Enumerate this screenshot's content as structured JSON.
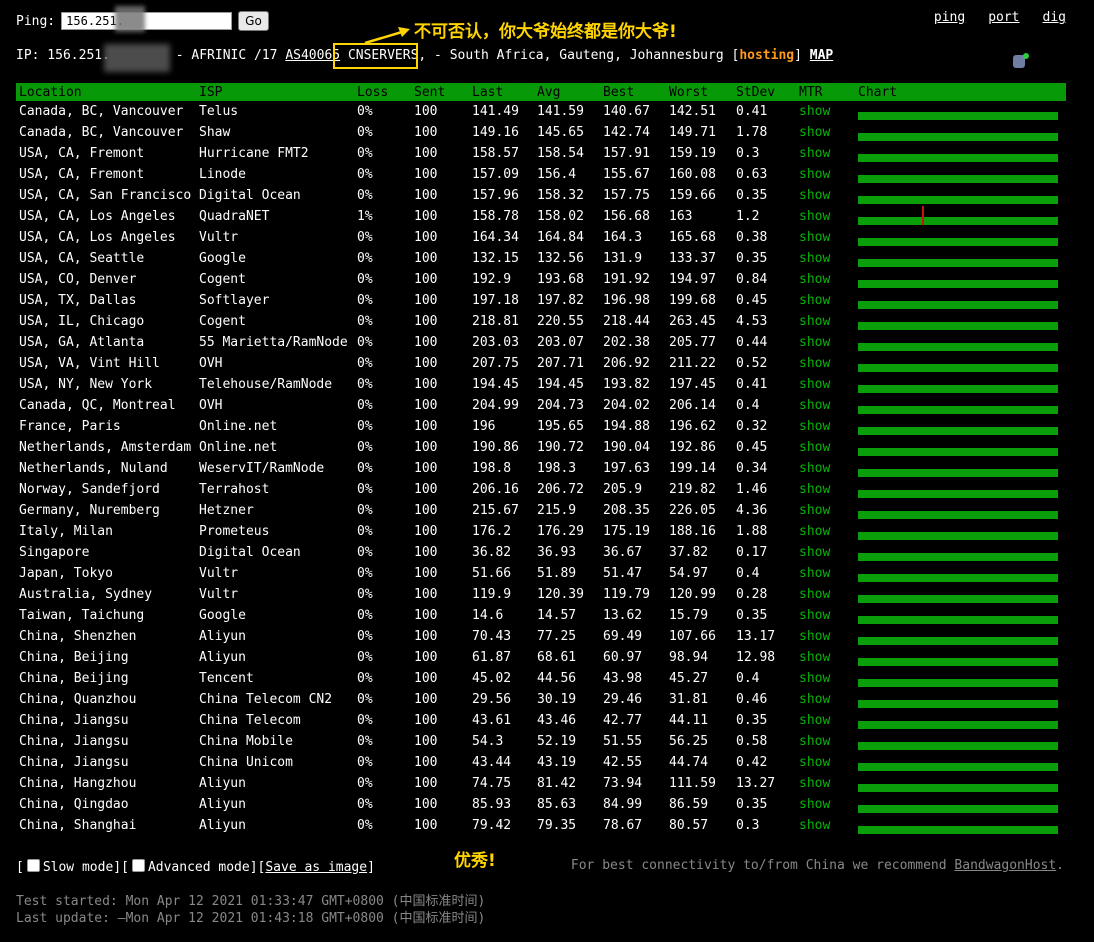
{
  "toolbar": {
    "ping_label": "Ping:",
    "ip_value": "156.251.",
    "go_label": "Go",
    "links": [
      "ping",
      "port",
      "dig"
    ]
  },
  "ip_info": {
    "prefix": "IP: 156.251.",
    "mid": " - AFRINIC /17 ",
    "asn": "AS40065",
    "org": "CNSERVERS,",
    "location": " - South Africa, Gauteng, Johannesburg [",
    "hosting": "hosting",
    "close": "] ",
    "map": "MAP"
  },
  "annotations": {
    "top": "不可否认，你大爷始终都是你大爷!",
    "bottom": "优秀!"
  },
  "table": {
    "headers": [
      "Location",
      "ISP",
      "Loss",
      "Sent",
      "Last",
      "Avg",
      "Best",
      "Worst",
      "StDev",
      "MTR",
      "Chart"
    ],
    "rows": [
      {
        "location": "Canada, BC, Vancouver",
        "isp": "Telus",
        "loss": "0%",
        "sent": "100",
        "last": "141.49",
        "avg": "141.59",
        "best": "140.67",
        "worst": "142.51",
        "stdev": "0.41",
        "mtr": "show"
      },
      {
        "location": "Canada, BC, Vancouver",
        "isp": "Shaw",
        "loss": "0%",
        "sent": "100",
        "last": "149.16",
        "avg": "145.65",
        "best": "142.74",
        "worst": "149.71",
        "stdev": "1.78",
        "mtr": "show"
      },
      {
        "location": "USA, CA, Fremont",
        "isp": "Hurricane FMT2",
        "loss": "0%",
        "sent": "100",
        "last": "158.57",
        "avg": "158.54",
        "best": "157.91",
        "worst": "159.19",
        "stdev": "0.3",
        "mtr": "show"
      },
      {
        "location": "USA, CA, Fremont",
        "isp": "Linode",
        "loss": "0%",
        "sent": "100",
        "last": "157.09",
        "avg": "156.4",
        "best": "155.67",
        "worst": "160.08",
        "stdev": "0.63",
        "mtr": "show"
      },
      {
        "location": "USA, CA, San Francisco",
        "isp": "Digital Ocean",
        "loss": "0%",
        "sent": "100",
        "last": "157.96",
        "avg": "158.32",
        "best": "157.75",
        "worst": "159.66",
        "stdev": "0.35",
        "mtr": "show"
      },
      {
        "location": "USA, CA, Los Angeles",
        "isp": "QuadraNET",
        "loss": "1%",
        "sent": "100",
        "last": "158.78",
        "avg": "158.02",
        "best": "156.68",
        "worst": "163",
        "stdev": "1.2",
        "mtr": "show",
        "spike": true
      },
      {
        "location": "USA, CA, Los Angeles",
        "isp": "Vultr",
        "loss": "0%",
        "sent": "100",
        "last": "164.34",
        "avg": "164.84",
        "best": "164.3",
        "worst": "165.68",
        "stdev": "0.38",
        "mtr": "show"
      },
      {
        "location": "USA, CA, Seattle",
        "isp": "Google",
        "loss": "0%",
        "sent": "100",
        "last": "132.15",
        "avg": "132.56",
        "best": "131.9",
        "worst": "133.37",
        "stdev": "0.35",
        "mtr": "show"
      },
      {
        "location": "USA, CO, Denver",
        "isp": "Cogent",
        "loss": "0%",
        "sent": "100",
        "last": "192.9",
        "avg": "193.68",
        "best": "191.92",
        "worst": "194.97",
        "stdev": "0.84",
        "mtr": "show"
      },
      {
        "location": "USA, TX, Dallas",
        "isp": "Softlayer",
        "loss": "0%",
        "sent": "100",
        "last": "197.18",
        "avg": "197.82",
        "best": "196.98",
        "worst": "199.68",
        "stdev": "0.45",
        "mtr": "show"
      },
      {
        "location": "USA, IL, Chicago",
        "isp": "Cogent",
        "loss": "0%",
        "sent": "100",
        "last": "218.81",
        "avg": "220.55",
        "best": "218.44",
        "worst": "263.45",
        "stdev": "4.53",
        "mtr": "show"
      },
      {
        "location": "USA, GA, Atlanta",
        "isp": "55 Marietta/RamNode",
        "loss": "0%",
        "sent": "100",
        "last": "203.03",
        "avg": "203.07",
        "best": "202.38",
        "worst": "205.77",
        "stdev": "0.44",
        "mtr": "show"
      },
      {
        "location": "USA, VA, Vint Hill",
        "isp": "OVH",
        "loss": "0%",
        "sent": "100",
        "last": "207.75",
        "avg": "207.71",
        "best": "206.92",
        "worst": "211.22",
        "stdev": "0.52",
        "mtr": "show"
      },
      {
        "location": "USA, NY, New York",
        "isp": "Telehouse/RamNode",
        "loss": "0%",
        "sent": "100",
        "last": "194.45",
        "avg": "194.45",
        "best": "193.82",
        "worst": "197.45",
        "stdev": "0.41",
        "mtr": "show"
      },
      {
        "location": "Canada, QC, Montreal",
        "isp": "OVH",
        "loss": "0%",
        "sent": "100",
        "last": "204.99",
        "avg": "204.73",
        "best": "204.02",
        "worst": "206.14",
        "stdev": "0.4",
        "mtr": "show"
      },
      {
        "location": "France, Paris",
        "isp": "Online.net",
        "loss": "0%",
        "sent": "100",
        "last": "196",
        "avg": "195.65",
        "best": "194.88",
        "worst": "196.62",
        "stdev": "0.32",
        "mtr": "show"
      },
      {
        "location": "Netherlands, Amsterdam",
        "isp": "Online.net",
        "loss": "0%",
        "sent": "100",
        "last": "190.86",
        "avg": "190.72",
        "best": "190.04",
        "worst": "192.86",
        "stdev": "0.45",
        "mtr": "show"
      },
      {
        "location": "Netherlands, Nuland",
        "isp": "WeservIT/RamNode",
        "loss": "0%",
        "sent": "100",
        "last": "198.8",
        "avg": "198.3",
        "best": "197.63",
        "worst": "199.14",
        "stdev": "0.34",
        "mtr": "show"
      },
      {
        "location": "Norway, Sandefjord",
        "isp": "Terrahost",
        "loss": "0%",
        "sent": "100",
        "last": "206.16",
        "avg": "206.72",
        "best": "205.9",
        "worst": "219.82",
        "stdev": "1.46",
        "mtr": "show"
      },
      {
        "location": "Germany, Nuremberg",
        "isp": "Hetzner",
        "loss": "0%",
        "sent": "100",
        "last": "215.67",
        "avg": "215.9",
        "best": "208.35",
        "worst": "226.05",
        "stdev": "4.36",
        "mtr": "show"
      },
      {
        "location": "Italy, Milan",
        "isp": "Prometeus",
        "loss": "0%",
        "sent": "100",
        "last": "176.2",
        "avg": "176.29",
        "best": "175.19",
        "worst": "188.16",
        "stdev": "1.88",
        "mtr": "show"
      },
      {
        "location": "Singapore",
        "isp": "Digital Ocean",
        "loss": "0%",
        "sent": "100",
        "last": "36.82",
        "avg": "36.93",
        "best": "36.67",
        "worst": "37.82",
        "stdev": "0.17",
        "mtr": "show"
      },
      {
        "location": "Japan, Tokyo",
        "isp": "Vultr",
        "loss": "0%",
        "sent": "100",
        "last": "51.66",
        "avg": "51.89",
        "best": "51.47",
        "worst": "54.97",
        "stdev": "0.4",
        "mtr": "show"
      },
      {
        "location": "Australia, Sydney",
        "isp": "Vultr",
        "loss": "0%",
        "sent": "100",
        "last": "119.9",
        "avg": "120.39",
        "best": "119.79",
        "worst": "120.99",
        "stdev": "0.28",
        "mtr": "show"
      },
      {
        "location": "Taiwan, Taichung",
        "isp": "Google",
        "loss": "0%",
        "sent": "100",
        "last": "14.6",
        "avg": "14.57",
        "best": "13.62",
        "worst": "15.79",
        "stdev": "0.35",
        "mtr": "show"
      },
      {
        "location": "China, Shenzhen",
        "isp": "Aliyun",
        "loss": "0%",
        "sent": "100",
        "last": "70.43",
        "avg": "77.25",
        "best": "69.49",
        "worst": "107.66",
        "stdev": "13.17",
        "mtr": "show"
      },
      {
        "location": "China, Beijing",
        "isp": "Aliyun",
        "loss": "0%",
        "sent": "100",
        "last": "61.87",
        "avg": "68.61",
        "best": "60.97",
        "worst": "98.94",
        "stdev": "12.98",
        "mtr": "show"
      },
      {
        "location": "China, Beijing",
        "isp": "Tencent",
        "loss": "0%",
        "sent": "100",
        "last": "45.02",
        "avg": "44.56",
        "best": "43.98",
        "worst": "45.27",
        "stdev": "0.4",
        "mtr": "show"
      },
      {
        "location": "China, Quanzhou",
        "isp": "China Telecom CN2",
        "loss": "0%",
        "sent": "100",
        "last": "29.56",
        "avg": "30.19",
        "best": "29.46",
        "worst": "31.81",
        "stdev": "0.46",
        "mtr": "show"
      },
      {
        "location": "China, Jiangsu",
        "isp": "China Telecom",
        "loss": "0%",
        "sent": "100",
        "last": "43.61",
        "avg": "43.46",
        "best": "42.77",
        "worst": "44.11",
        "stdev": "0.35",
        "mtr": "show"
      },
      {
        "location": "China, Jiangsu",
        "isp": "China Mobile",
        "loss": "0%",
        "sent": "100",
        "last": "54.3",
        "avg": "52.19",
        "best": "51.55",
        "worst": "56.25",
        "stdev": "0.58",
        "mtr": "show"
      },
      {
        "location": "China, Jiangsu",
        "isp": "China Unicom",
        "loss": "0%",
        "sent": "100",
        "last": "43.44",
        "avg": "43.19",
        "best": "42.55",
        "worst": "44.74",
        "stdev": "0.42",
        "mtr": "show"
      },
      {
        "location": "China, Hangzhou",
        "isp": "Aliyun",
        "loss": "0%",
        "sent": "100",
        "last": "74.75",
        "avg": "81.42",
        "best": "73.94",
        "worst": "111.59",
        "stdev": "13.27",
        "mtr": "show"
      },
      {
        "location": "China, Qingdao",
        "isp": "Aliyun",
        "loss": "0%",
        "sent": "100",
        "last": "85.93",
        "avg": "85.63",
        "best": "84.99",
        "worst": "86.59",
        "stdev": "0.35",
        "mtr": "show"
      },
      {
        "location": "China, Shanghai",
        "isp": "Aliyun",
        "loss": "0%",
        "sent": "100",
        "last": "79.42",
        "avg": "79.35",
        "best": "78.67",
        "worst": "80.57",
        "stdev": "0.3",
        "mtr": "show"
      }
    ]
  },
  "options": {
    "slow_mode": "Slow mode",
    "advanced_mode": "Advanced mode",
    "save_image": "Save as image"
  },
  "recommend": {
    "text": "For best connectivity to/from China we recommend ",
    "link": "BandwagonHost",
    "end": "."
  },
  "status": {
    "started": "Test started: Mon Apr 12 2021 01:33:47 GMT+0800 (中国标准时间)",
    "updated": "Last update: —Mon Apr 12 2021 01:43:18 GMT+0800 (中国标准时间)"
  },
  "colors": {
    "header_bg": "#079907",
    "bar": "#0a9e0a",
    "mtr_link": "#09b409",
    "hosting": "#ff9a1a",
    "annotation": "#ffd400"
  }
}
